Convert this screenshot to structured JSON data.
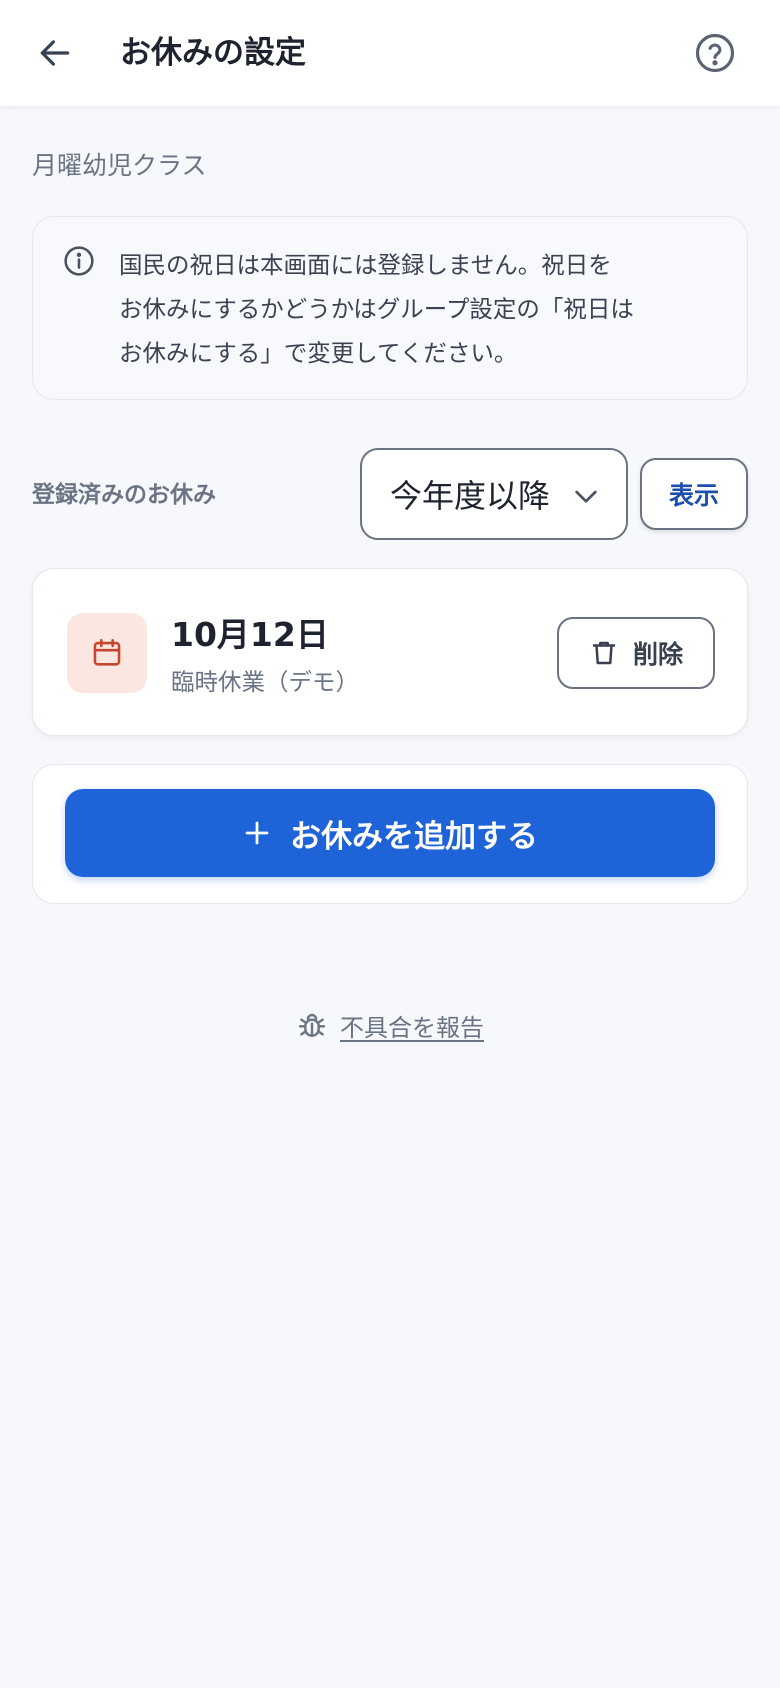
{
  "header": {
    "title": "お休みの設定",
    "back_icon": "arrow-left-icon",
    "help_icon": "question-circle-icon"
  },
  "class_name": "月曜幼児クラス",
  "notice": {
    "icon": "info-circle-icon",
    "lines": [
      "国民の祝日は本画面には登録しません。祝日を",
      "お休みにするかどうかはグループ設定の「祝日は",
      "お休みにする」で変更してください。"
    ]
  },
  "filter": {
    "label": "登録済みのお休み",
    "selected": "今年度以降",
    "show_button": "表示"
  },
  "holidays": [
    {
      "date": "10月12日",
      "reason": "臨時休業（デモ）",
      "icon": "calendar-icon",
      "delete_label": "削除"
    }
  ],
  "add_button": {
    "label": "お休みを追加する",
    "icon": "plus-icon"
  },
  "footer": {
    "report_label": "不具合を報告",
    "icon": "bug-icon"
  },
  "colors": {
    "primary": "#1f63d8",
    "calendar_bg": "#fbe6e0",
    "calendar_icon": "#c4472f",
    "link_text": "#1e4fae"
  }
}
